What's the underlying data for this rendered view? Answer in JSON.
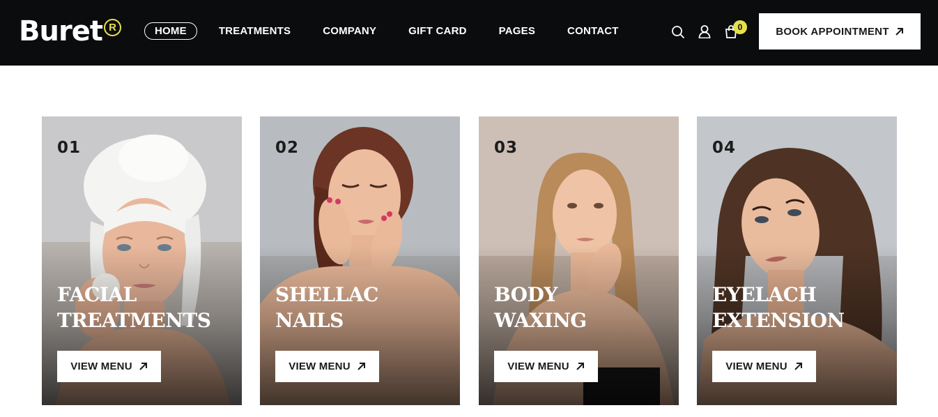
{
  "header": {
    "logo": "Buret",
    "logo_mark": "R",
    "nav": [
      {
        "label": "HOME",
        "active": true
      },
      {
        "label": "TREATMENTS",
        "active": false
      },
      {
        "label": "COMPANY",
        "active": false
      },
      {
        "label": "GIFT CARD",
        "active": false
      },
      {
        "label": "PAGES",
        "active": false
      },
      {
        "label": "CONTACT",
        "active": false
      }
    ],
    "cart_count": "0",
    "book_label": "BOOK APPOINTMENT",
    "icons": [
      "search-icon",
      "user-icon",
      "shopping-bag-icon"
    ]
  },
  "cards": [
    {
      "number": "01",
      "title": "FACIAL\nTREATMENTS",
      "button": "VIEW MENU"
    },
    {
      "number": "02",
      "title": "SHELLAC\nNAILS",
      "button": "VIEW MENU"
    },
    {
      "number": "03",
      "title": "BODY\nWAXING",
      "button": "VIEW MENU"
    },
    {
      "number": "04",
      "title": "EYELACH\nEXTENSION",
      "button": "VIEW MENU"
    }
  ],
  "colors": {
    "header_bg": "#0b0c0e",
    "accent": "#e6e14a",
    "text_light": "#ffffff"
  }
}
